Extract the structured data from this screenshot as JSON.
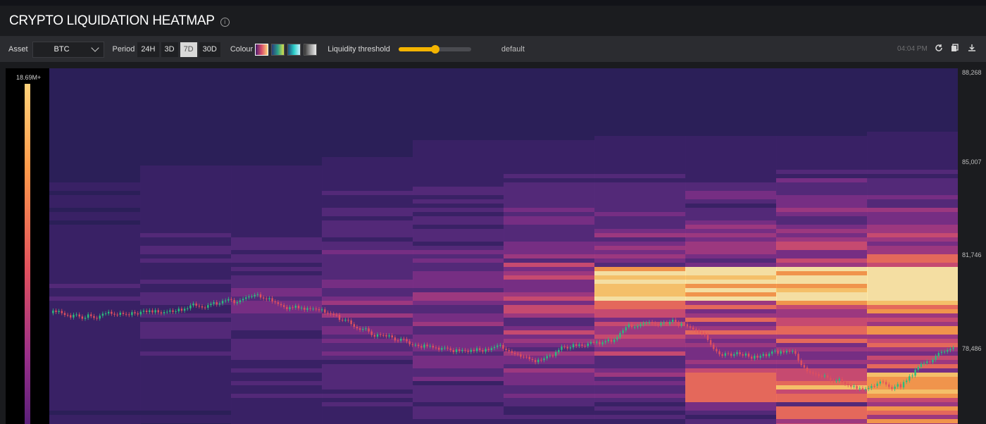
{
  "header": {
    "title": "CRYPTO LIQUIDATION HEATMAP"
  },
  "toolbar": {
    "asset_label": "Asset",
    "asset_value": "BTC",
    "period_label": "Period",
    "periods": [
      "24H",
      "3D",
      "7D",
      "30D"
    ],
    "active_period": "7D",
    "colour_label": "Colour",
    "threshold_label": "Liquidity threshold",
    "threshold_value": "default",
    "time": "04:04 PM"
  },
  "legend": {
    "max_label": "18.69M+"
  },
  "yaxis": {
    "ticks": [
      "88,268",
      "85,007",
      "81,746",
      "78,486"
    ]
  },
  "colors": {
    "accent": "#f4b400",
    "up_candle": "#2bbd7e",
    "down_candle": "#e0505e"
  },
  "icons": [
    "info-icon",
    "refresh-icon",
    "copy-icon",
    "download-icon"
  ]
}
